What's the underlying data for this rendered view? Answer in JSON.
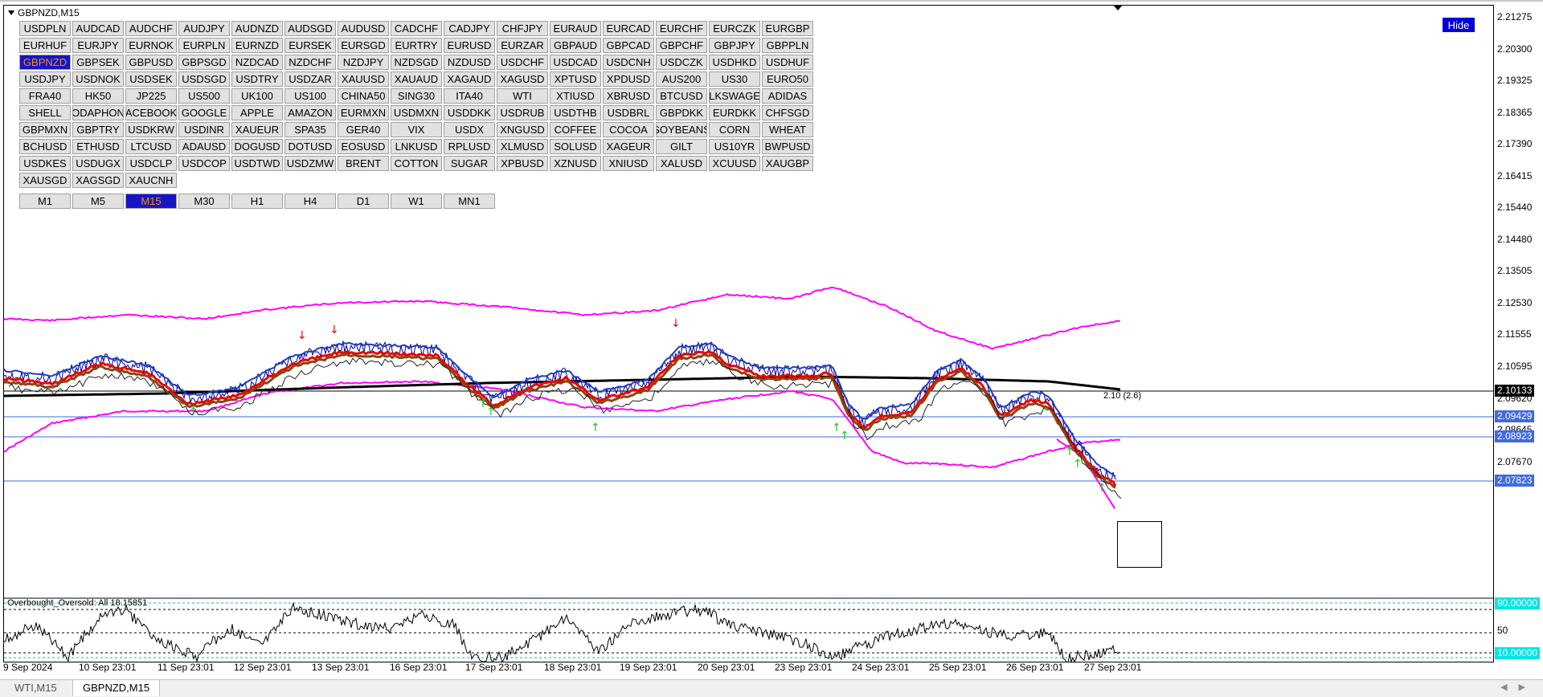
{
  "window": {
    "title": "GBPNZD,M15"
  },
  "symbols": [
    "USDPLN",
    "AUDCAD",
    "AUDCHF",
    "AUDJPY",
    "AUDNZD",
    "AUDSGD",
    "AUDUSD",
    "CADCHF",
    "CADJPY",
    "CHFJPY",
    "EURAUD",
    "EURCAD",
    "EURCHF",
    "EURCZK",
    "EURGBP",
    "EURHUF",
    "EURJPY",
    "EURNOK",
    "EURPLN",
    "EURNZD",
    "EURSEK",
    "EURSGD",
    "EURTRY",
    "EURUSD",
    "EURZAR",
    "GBPAUD",
    "GBPCAD",
    "GBPCHF",
    "GBPJPY",
    "GBPPLN",
    "GBPNZD",
    "GBPSEK",
    "GBPUSD",
    "GBPSGD",
    "NZDCAD",
    "NZDCHF",
    "NZDJPY",
    "NZDSGD",
    "NZDUSD",
    "USDCHF",
    "USDCAD",
    "USDCNH",
    "USDCZK",
    "USDHKD",
    "USDHUF",
    "USDJPY",
    "USDNOK",
    "USDSEK",
    "USDSGD",
    "USDTRY",
    "USDZAR",
    "XAUUSD",
    "XAUAUD",
    "XAGAUD",
    "XAGUSD",
    "XPTUSD",
    "XPDUSD",
    "AUS200",
    "US30",
    "EURO50",
    "FRA40",
    "HK50",
    "JP225",
    "US500",
    "UK100",
    "US100",
    "CHINA50",
    "SING30",
    "ITA40",
    "WTI",
    "XTIUSD",
    "XBRUSD",
    "BTCUSD",
    "LKSWAGE",
    "ADIDAS",
    "SHELL",
    "ODAPHON",
    "ACEBOOK",
    "GOOGLE",
    "APPLE",
    "AMAZON",
    "EURMXN",
    "USDMXN",
    "USDDKK",
    "USDRUB",
    "USDTHB",
    "USDBRL",
    "GBPDKK",
    "EURDKK",
    "CHFSGD",
    "GBPMXN",
    "GBPTRY",
    "USDKRW",
    "USDINR",
    "XAUEUR",
    "SPA35",
    "GER40",
    "VIX",
    "USDX",
    "XNGUSD",
    "COFFEE",
    "COCOA",
    "SOYBEANS",
    "CORN",
    "WHEAT",
    "BCHUSD",
    "ETHUSD",
    "LTCUSD",
    "ADAUSD",
    "DOGUSD",
    "DOTUSD",
    "EOSUSD",
    "LNKUSD",
    "RPLUSD",
    "XLMUSD",
    "SOLUSD",
    "XAGEUR",
    "GILT",
    "US10YR",
    "BWPUSD",
    "USDKES",
    "USDUGX",
    "USDCLP",
    "USDCOP",
    "USDTWD",
    "USDZMW",
    "BRENT",
    "COTTON",
    "SUGAR",
    "XPBUSD",
    "XZNUSD",
    "XNIUSD",
    "XALUSD",
    "XCUUSD",
    "XAUGBP",
    "XAUSGD",
    "XAGSGD",
    "XAUCNH"
  ],
  "active_symbol": "GBPNZD",
  "timeframes": [
    "M1",
    "M5",
    "M15",
    "M30",
    "H1",
    "H4",
    "D1",
    "W1",
    "MN1"
  ],
  "active_timeframe": "M15",
  "hide_button": "Hide",
  "price_axis": [
    "2.21275",
    "2.20300",
    "2.19325",
    "2.18365",
    "2.17390",
    "2.16415",
    "2.15440",
    "2.14480",
    "2.13505",
    "2.12530",
    "2.11555",
    "2.10595",
    "2.09620",
    "2.08645",
    "2.07670"
  ],
  "price_tags": [
    {
      "value": "2.10133",
      "bg": "#000000",
      "fg": "#ffffff"
    },
    {
      "value": "2.09429",
      "bg": "#4169e1",
      "fg": "#ffffff"
    },
    {
      "value": "2.08923",
      "bg": "#4169e1",
      "fg": "#ffffff"
    },
    {
      "value": "2.07823",
      "bg": "#4169e1",
      "fg": "#ffffff"
    }
  ],
  "cursor_annotation": "2.10 (2.6)",
  "indicator": {
    "label": "Overbought_Oversold: All 18.15851",
    "levels": [
      "50",
      "20"
    ],
    "tags": [
      {
        "value": "90.00000",
        "bg": "#00e5e5",
        "fg": "#ffffff"
      },
      {
        "value": "10.00000",
        "bg": "#00e5e5",
        "fg": "#ffffff"
      }
    ]
  },
  "time_axis": [
    "9 Sep 2024",
    "10 Sep 23:01",
    "11 Sep 23:01",
    "12 Sep 23:01",
    "13 Sep 23:01",
    "16 Sep 23:01",
    "17 Sep 23:01",
    "18 Sep 23:01",
    "19 Sep 23:01",
    "20 Sep 23:01",
    "23 Sep 23:01",
    "24 Sep 23:01",
    "25 Sep 23:01",
    "26 Sep 23:01",
    "27 Sep 23:01"
  ],
  "tabs": [
    {
      "label": "WTI,M15",
      "active": false
    },
    {
      "label": "GBPNZD,M15",
      "active": true
    }
  ],
  "colors": {
    "button_bg": "#e1e1e1",
    "active_bg": "#1515c8",
    "active_fg": "#ff8c00",
    "bollinger": "#ff00ff",
    "ema_red": "#ee0000",
    "ema_brown": "#8b4513",
    "ema_blue": "#1e3cc8",
    "ma_black": "#000000"
  }
}
